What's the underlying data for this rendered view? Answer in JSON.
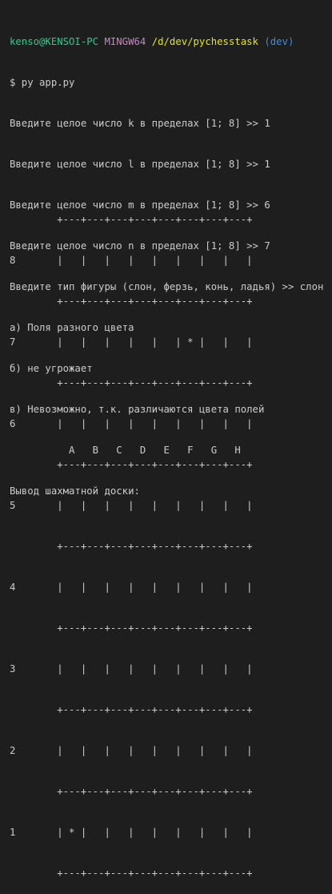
{
  "prompt": {
    "user_host": "kenso@KENSOI-PC",
    "system": "MINGW64",
    "path": "/d/dev/pychesstask",
    "branch": "(dev)",
    "command": "$ py app.py"
  },
  "output_lines": [
    "Введите целое число k в пределах [1; 8] >> 1",
    "Введите целое число l в пределах [1; 8] >> 1",
    "Введите целое число m в пределах [1; 8] >> 6",
    "Введите целое число n в пределах [1; 8] >> 7",
    "Введите тип фигуры (слон, ферзь, конь, ладья) >> слон",
    "а) Поля разного цвета",
    "б) не угрожает",
    "в) Невозможно, т.к. различаются цвета полей",
    "",
    "Вывод шахматной доски:"
  ],
  "board": {
    "border": "        +---+---+---+---+---+---+---+---+",
    "rows": [
      "8       |   |   |   |   |   |   |   |   |",
      "7       |   |   |   |   |   | * |   |   |",
      "6       |   |   |   |   |   |   |   |   |",
      "5       |   |   |   |   |   |   |   |   |",
      "4       |   |   |   |   |   |   |   |   |",
      "3       |   |   |   |   |   |   |   |   |",
      "2       |   |   |   |   |   |   |   |   |",
      "1       | * |   |   |   |   |   |   |   |"
    ],
    "files": "          A   B   C   D   E   F   G   H"
  }
}
